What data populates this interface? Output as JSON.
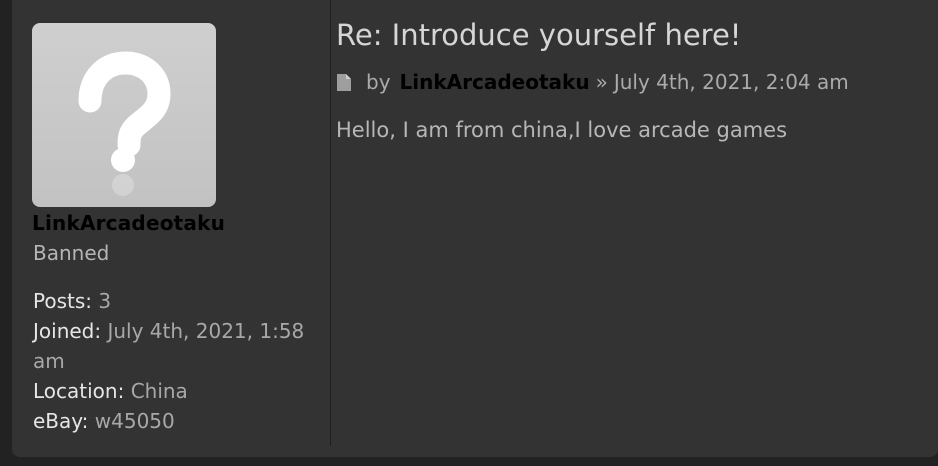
{
  "profile": {
    "username": "LinkArcadeotaku",
    "rank": "Banned",
    "posts_label": "Posts:",
    "posts_value": "3",
    "joined_label": "Joined:",
    "joined_value": "July 4th, 2021, 1:58 am",
    "location_label": "Location:",
    "location_value": "China",
    "ebay_label": "eBay:",
    "ebay_value": "w45050"
  },
  "post": {
    "title": "Re: Introduce yourself here!",
    "by_label": "by",
    "author": "LinkArcadeotaku",
    "separator": "»",
    "datetime": "July 4th, 2021, 2:04 am",
    "content": "Hello, I am from china,I love arcade games"
  },
  "icons": {
    "avatar": "question-mark-placeholder",
    "post": "document-icon"
  }
}
